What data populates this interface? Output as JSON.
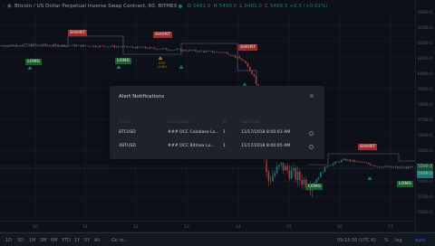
{
  "header": {
    "title": "Bitcoin / US Dollar Perpetual Inverse Swap Contract, 60, BITMEX",
    "open_label": "O",
    "open": "5481.0",
    "high_label": "H",
    "high": "5490.0",
    "low_label": "L",
    "low": "5481.0",
    "close_label": "C",
    "close": "5489.5",
    "change": "+0.5 (+0.01%)"
  },
  "price_axis": [
    "6400.0",
    "6300.0",
    "6200.0",
    "6100.0",
    "6000.0",
    "5900.0",
    "5800.0",
    "5700.0",
    "5600.0",
    "5500.0",
    "5400.0",
    "5300.0",
    "5200.0"
  ],
  "price_tags": [
    "5500.0",
    "5489.5"
  ],
  "time_axis": [
    "10",
    "11",
    "12",
    "13",
    "14",
    "15",
    "16",
    "17"
  ],
  "signals": {
    "short": "SHORT",
    "long": "LONG",
    "exit": "EXIT LONG"
  },
  "modal": {
    "title": "Alert Notifications",
    "close_icon": "×",
    "headers": {
      "symbol": "Ticker",
      "description": "Description",
      "count": "#",
      "last_fired": "Last Fired"
    },
    "rows": [
      {
        "symbol": "BTCUSD",
        "description": "### OCC Coinbase Lo...",
        "count": "1",
        "last_fired": "11/17/2018 8:00:03 AM"
      },
      {
        "symbol": "XBTUSD",
        "description": "### OCC Bitmex Lo...",
        "count": "1",
        "last_fired": "11/17/2018 8:00:05 AM"
      }
    ]
  },
  "bottom_bar": {
    "timeframes": [
      "1D",
      "5D",
      "1M",
      "3M",
      "6M",
      "YTD",
      "1Y",
      "5Y",
      "All"
    ],
    "goto": "Go to...",
    "clock": "09:18:50 (UTC-6)",
    "percent": "%",
    "log": "log",
    "auto": "auto"
  },
  "colors": {
    "up": "#26a69a",
    "down": "#ef5350",
    "short_flag": "#e53935",
    "long_flag": "#1b8a3a"
  },
  "chart_data": {
    "type": "candlestick",
    "symbol": "XBTUSD",
    "interval": "60",
    "exchange": "BITMEX",
    "x_ticks": [
      "10",
      "11",
      "12",
      "13",
      "14",
      "15",
      "16",
      "17"
    ],
    "y_ticks": [
      6400,
      6300,
      6200,
      6100,
      6000,
      5900,
      5800,
      5700,
      5600,
      5500,
      5400,
      5300,
      5200
    ],
    "ylim": [
      5150,
      6480
    ],
    "last_close": 5489.5,
    "signals": [
      {
        "type": "SHORT",
        "day": 10.8,
        "price": 6330
      },
      {
        "type": "LONG",
        "day": 10.0,
        "price": 6280
      },
      {
        "type": "LONG",
        "day": 11.8,
        "price": 6290
      },
      {
        "type": "SHORT",
        "day": 12.55,
        "price": 6330
      },
      {
        "type": "EXIT LONG",
        "day": 12.55,
        "price": 6200
      },
      {
        "type": "SHORT",
        "day": 14.2,
        "price": 6280
      },
      {
        "type": "LONG",
        "day": 15.1,
        "price": 5380
      },
      {
        "type": "SHORT",
        "day": 16.7,
        "price": 5650
      },
      {
        "type": "LONG",
        "day": 17.3,
        "price": 5390
      }
    ]
  }
}
